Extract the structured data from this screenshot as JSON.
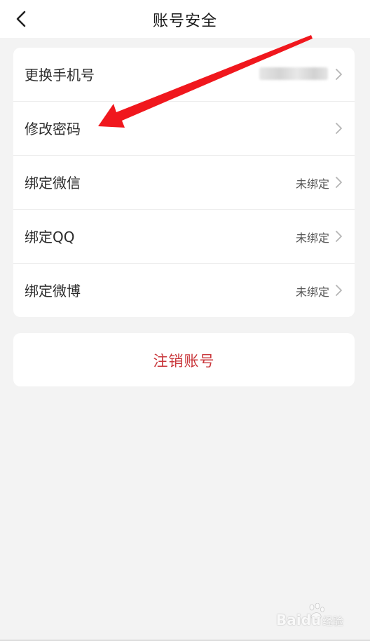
{
  "header": {
    "title": "账号安全",
    "back_icon": "chevron-left-icon"
  },
  "settings": {
    "items": [
      {
        "label": "更换手机号",
        "value": "",
        "value_blurred": true
      },
      {
        "label": "修改密码",
        "value": ""
      },
      {
        "label": "绑定微信",
        "value": "未绑定"
      },
      {
        "label": "绑定QQ",
        "value": "未绑定"
      },
      {
        "label": "绑定微博",
        "value": "未绑定"
      }
    ]
  },
  "logout": {
    "label": "注销账号",
    "color": "#c9373b"
  },
  "annotation": {
    "arrow_color": "#f0171d"
  },
  "watermark": {
    "brand": "Bai",
    "brand_tail": "du",
    "suffix": "经验"
  }
}
